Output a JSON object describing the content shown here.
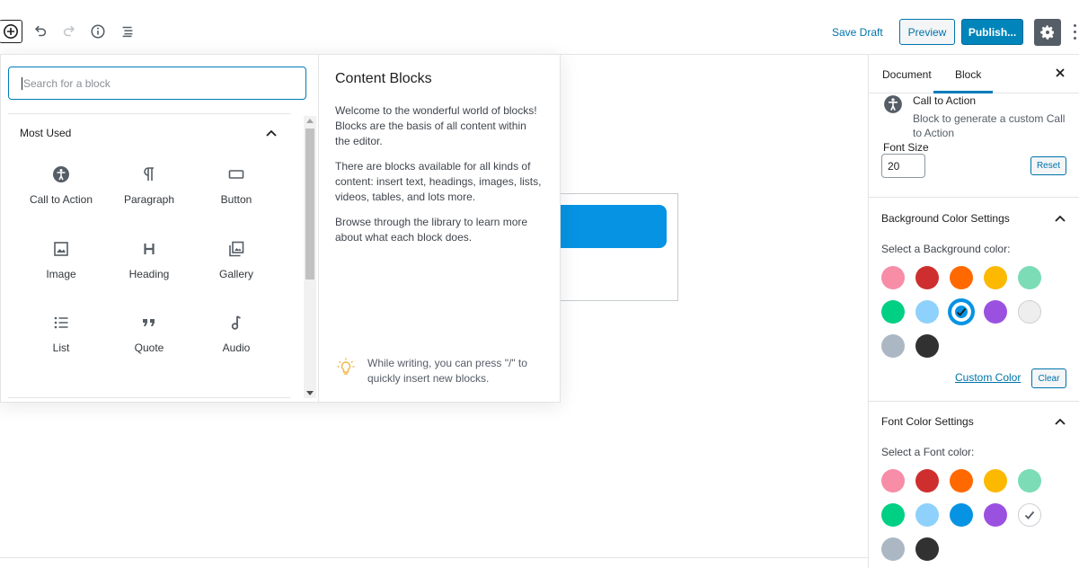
{
  "toolbar": {
    "save_draft": "Save Draft",
    "preview": "Preview",
    "publish": "Publish...",
    "icons": [
      "add-block-icon",
      "undo-icon",
      "redo-icon",
      "info-icon",
      "list-view-icon",
      "gear-icon",
      "more-icon"
    ]
  },
  "inserter": {
    "search_placeholder": "Search for a block",
    "section_title": "Most Used",
    "blocks": [
      {
        "label": "Call to Action",
        "icon": "accessibility-icon"
      },
      {
        "label": "Paragraph",
        "icon": "pilcrow-icon"
      },
      {
        "label": "Button",
        "icon": "button-icon"
      },
      {
        "label": "Image",
        "icon": "image-icon"
      },
      {
        "label": "Heading",
        "icon": "heading-icon"
      },
      {
        "label": "Gallery",
        "icon": "gallery-icon"
      },
      {
        "label": "List",
        "icon": "list-icon"
      },
      {
        "label": "Quote",
        "icon": "quote-icon"
      },
      {
        "label": "Audio",
        "icon": "audio-icon"
      }
    ],
    "info_title": "Content Blocks",
    "info_paragraphs": [
      "Welcome to the wonderful world of blocks! Blocks are the basis of all content within the editor.",
      "There are blocks available for all kinds of content: insert text, headings, images, lists, videos, tables, and lots more.",
      "Browse through the library to learn more about what each block does."
    ],
    "tip": "While writing, you can press \"/\" to quickly insert new blocks."
  },
  "sidebar": {
    "tab_document": "Document",
    "tab_block": "Block",
    "block_title": "Call to Action",
    "block_desc": "Block to generate a custom Call to Action",
    "font_size_label": "Font Size",
    "font_size_value": "20",
    "reset": "Reset",
    "bg_panel_title": "Background Color Settings",
    "bg_select_label": "Select a Background color:",
    "custom_color": "Custom Color",
    "clear": "Clear",
    "font_panel_title": "Font Color Settings",
    "font_select_label": "Select a Font color:",
    "bg_colors": [
      "#f78da7",
      "#cf2e2e",
      "#ff6900",
      "#fcb900",
      "#7bdcb5",
      "#00d084",
      "#8ed1fc",
      "#0693e3",
      "#9b51e0",
      "#eeeeee",
      "#abb8c3",
      "#313131"
    ],
    "bg_selected": 7,
    "font_colors": [
      "#f78da7",
      "#cf2e2e",
      "#ff6900",
      "#fcb900",
      "#7bdcb5",
      "#00d084",
      "#8ed1fc",
      "#0693e3",
      "#9b51e0",
      "#ffffff",
      "#abb8c3",
      "#313131"
    ],
    "font_selected": 9
  },
  "canvas": {
    "button_color": "#0693e3"
  }
}
